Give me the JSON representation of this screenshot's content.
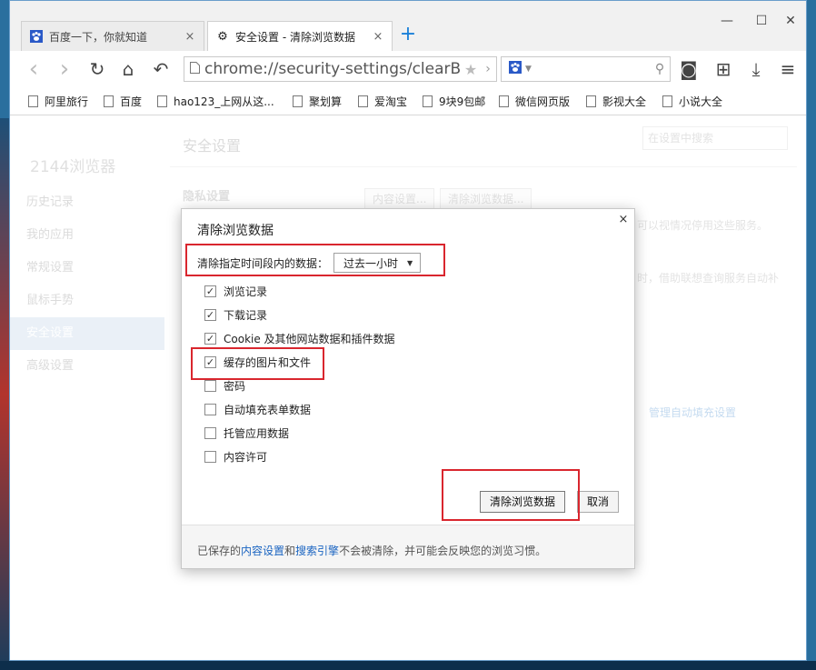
{
  "tabs": [
    {
      "title": "百度一下，你就知道",
      "icon": "paw-icon",
      "close": "×"
    },
    {
      "title": "安全设置 - 清除浏览数据",
      "icon": "gear-icon",
      "close": "×"
    }
  ],
  "new_tab": "+",
  "window_controls": {
    "minimize": "—",
    "maximize": "☐",
    "close": "✕"
  },
  "toolbar": {
    "back": "‹",
    "forward": "›",
    "reload": "↻",
    "home": "⌂",
    "undo": "↶",
    "address_url": "chrome://security-settings/clearBrov",
    "star": "★",
    "more": "›",
    "search_engine_icon": "paw-icon",
    "search_placeholder": "",
    "search_glyph": "⚲",
    "screenshot": "◙",
    "extensions": "⊞",
    "download": "⤓",
    "menu": "≡"
  },
  "bookmarks": [
    "阿里旅行",
    "百度",
    "hao123_上网从这...",
    "聚划算",
    "爱淘宝",
    "9块9包邮",
    "微信网页版",
    "影视大全",
    "小说大全"
  ],
  "settings": {
    "brand": "2144浏览器",
    "nav": [
      "历史记录",
      "我的应用",
      "常规设置",
      "鼠标手势",
      "安全设置",
      "高级设置"
    ],
    "active_nav": "安全设置",
    "page_title": "安全设置",
    "search_placeholder": "在设置中搜索",
    "privacy_heading": "隐私设置",
    "content_settings_btn": "内容设置...",
    "clear_data_btn": "清除浏览数据...",
    "bg_text_1": "可以视情况停用这些服务。",
    "bg_text_2": "时，借助联想查询服务自动补",
    "bg_link_autofill": "管理自动填充设置"
  },
  "dialog": {
    "title": "清除浏览数据",
    "close": "×",
    "range_label": "清除指定时间段内的数据：",
    "range_value": "过去一小时",
    "options": [
      {
        "label": "浏览记录",
        "checked": true
      },
      {
        "label": "下载记录",
        "checked": true
      },
      {
        "label": "Cookie 及其他网站数据和插件数据",
        "checked": true
      },
      {
        "label": "缓存的图片和文件",
        "checked": true
      },
      {
        "label": "密码",
        "checked": false
      },
      {
        "label": "自动填充表单数据",
        "checked": false
      },
      {
        "label": "托管应用数据",
        "checked": false
      },
      {
        "label": "内容许可",
        "checked": false
      }
    ],
    "clear_button": "清除浏览数据",
    "cancel_button": "取消",
    "footer": {
      "prefix": "已保存的",
      "link1": "内容设置",
      "and": "和",
      "link2": "搜索引擎",
      "suffix": "不会被清除，并可能会反映您的浏览习惯。"
    }
  },
  "colors": {
    "accent": "#1a64c1",
    "annotation": "#d9262e"
  }
}
